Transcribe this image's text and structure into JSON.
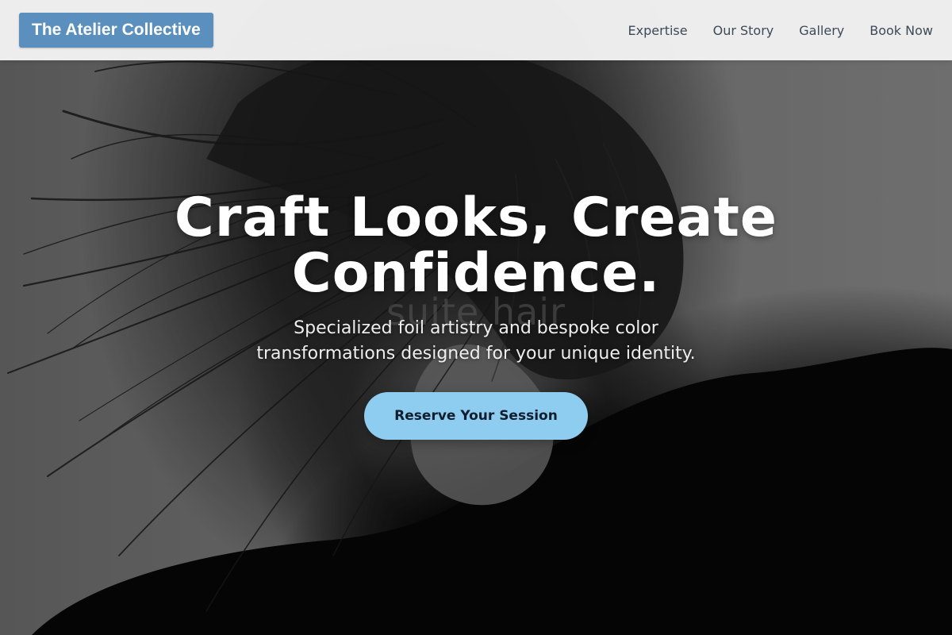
{
  "header": {
    "brand": "The Atelier Collective",
    "nav": [
      {
        "label": "Expertise"
      },
      {
        "label": "Our Story"
      },
      {
        "label": "Gallery"
      },
      {
        "label": "Book Now"
      }
    ]
  },
  "hero": {
    "title": "Craft Looks, Create Confidence.",
    "subtitle": "Specialized foil artistry and bespoke color transformations designed for your unique identity.",
    "cta_label": "Reserve Your Session",
    "background_watermark": "suite hair"
  },
  "colors": {
    "brand_bg": "#5b8fbd",
    "cta_bg": "#8ecdf0",
    "header_bg": "#f2f2f2",
    "nav_text": "#3d4a58"
  }
}
